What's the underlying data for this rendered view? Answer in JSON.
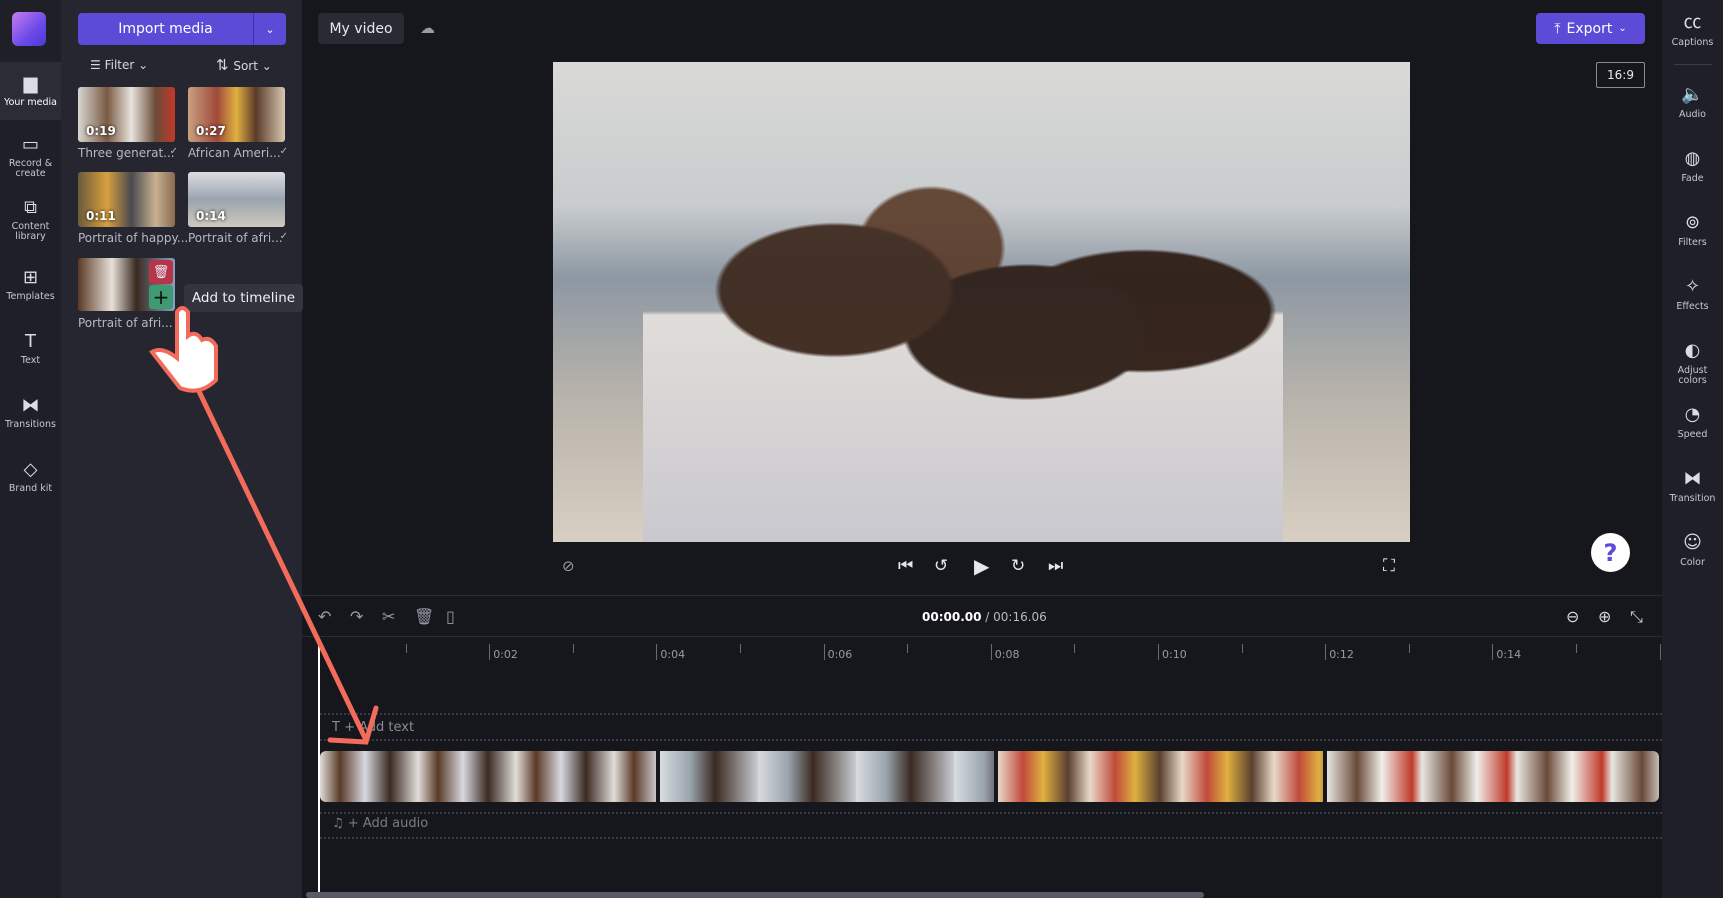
{
  "left_nav": {
    "items": [
      {
        "label": "Your media",
        "icon": "folder-icon",
        "active": true
      },
      {
        "label": "Record & create",
        "icon": "camera-icon"
      },
      {
        "label": "Content library",
        "icon": "content-library-icon"
      },
      {
        "label": "Templates",
        "icon": "templates-icon"
      },
      {
        "label": "Text",
        "icon": "text-icon"
      },
      {
        "label": "Transitions",
        "icon": "transitions-icon"
      },
      {
        "label": "Brand kit",
        "icon": "brand-kit-icon"
      }
    ]
  },
  "media_panel": {
    "import_label": "Import media",
    "filter_label": "Filter",
    "sort_label": "Sort",
    "items": [
      {
        "duration": "0:19",
        "title": "Three generat...",
        "added": true
      },
      {
        "duration": "0:27",
        "title": "African Ameri...",
        "added": true
      },
      {
        "duration": "0:11",
        "title": "Portrait of happy...",
        "added": false
      },
      {
        "duration": "0:14",
        "title": "Portrait of afri...",
        "added": true
      },
      {
        "duration": "",
        "title": "Portrait of afri...",
        "added": true,
        "hovered": true
      }
    ],
    "tooltip": "Add to timeline"
  },
  "top_bar": {
    "project_title": "My video",
    "export_label": "Export",
    "aspect_ratio": "16:9"
  },
  "timeline": {
    "current_time": "00:00.00",
    "total_time": "/ 00:16.06",
    "ruler_labels": [
      "0:02",
      "0:04",
      "0:06",
      "0:08",
      "0:10",
      "0:12",
      "0:14"
    ],
    "add_text": "+ Add text",
    "add_audio": "+ Add audio",
    "clip_count": 4
  },
  "right_nav": {
    "items": [
      {
        "label": "Captions",
        "icon": "captions-icon"
      },
      {
        "label": "Audio",
        "icon": "speaker-icon"
      },
      {
        "label": "Fade",
        "icon": "fade-icon"
      },
      {
        "label": "Filters",
        "icon": "filters-icon"
      },
      {
        "label": "Effects",
        "icon": "magic-wand-icon"
      },
      {
        "label": "Adjust colors",
        "icon": "contrast-icon"
      },
      {
        "label": "Speed",
        "icon": "speedometer-icon"
      },
      {
        "label": "Transition",
        "icon": "transition-icon"
      },
      {
        "label": "Color",
        "icon": "palette-icon"
      }
    ]
  },
  "colors": {
    "accent": "#5b4bd6",
    "annotation": "#f26b5b",
    "add_green": "#3f9a72",
    "delete_red": "#b5364a"
  }
}
